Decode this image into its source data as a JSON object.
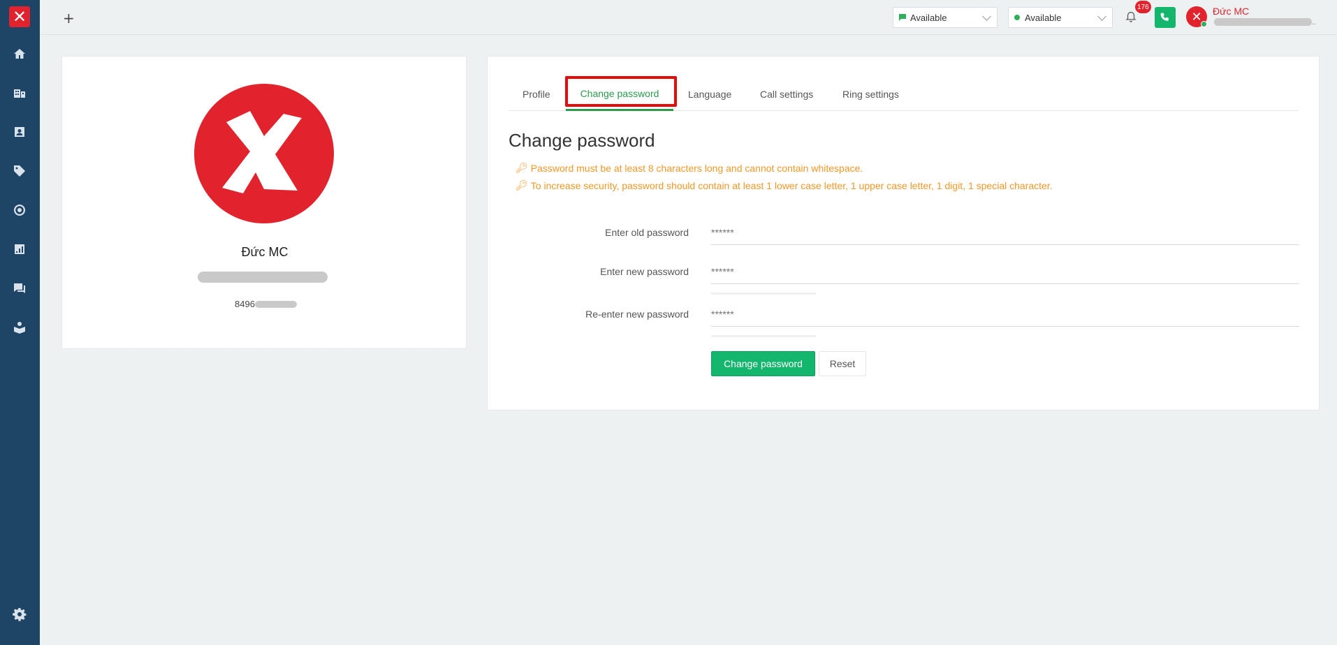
{
  "topbar": {
    "add_label": "+",
    "status1": "Available",
    "status2": "Available",
    "notification_count": "176",
    "user_name": "Đức MC",
    "user_sub_suffix": ".."
  },
  "profile": {
    "name": "Đức MC",
    "phone_prefix": "8496"
  },
  "tabs": [
    {
      "label": "Profile",
      "active": false
    },
    {
      "label": "Change password",
      "active": true
    },
    {
      "label": "Language",
      "active": false
    },
    {
      "label": "Call settings",
      "active": false
    },
    {
      "label": "Ring settings",
      "active": false
    }
  ],
  "form": {
    "title": "Change password",
    "hints": [
      "Password must be at least 8 characters long and cannot contain whitespace.",
      "To increase security, password should contain at least 1 lower case letter, 1 upper case letter, 1 digit, 1 special character."
    ],
    "fields": [
      {
        "label": "Enter old password",
        "placeholder": "******"
      },
      {
        "label": "Enter new password",
        "placeholder": "******"
      },
      {
        "label": "Re-enter new password",
        "placeholder": "******"
      }
    ],
    "submit_label": "Change password",
    "reset_label": "Reset"
  },
  "colors": {
    "sidebar": "#1f4566",
    "brand_red": "#e1232e",
    "accent_green": "#13b66c",
    "hint_orange": "#f0982a"
  }
}
